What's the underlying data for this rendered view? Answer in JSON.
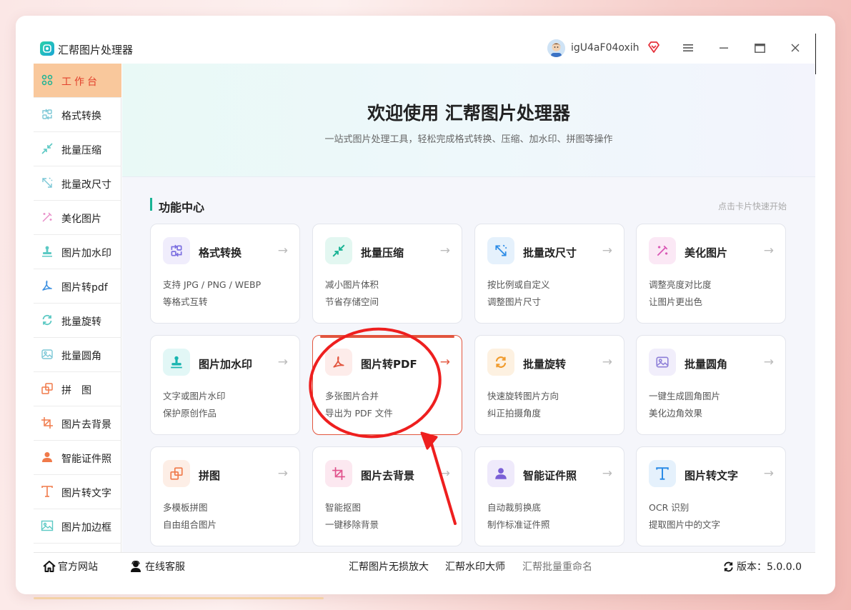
{
  "titlebar": {
    "app_title": "汇帮图片处理器",
    "username": "igU4aF04oxih",
    "menu_icon": "menu-icon",
    "minimize_icon": "minimize-icon",
    "maximize_icon": "maximize-icon",
    "close_icon": "close-icon"
  },
  "sidebar": {
    "items": [
      {
        "label": "工作台",
        "icon": "grid-icon",
        "active": true
      },
      {
        "label": "格式转换",
        "icon": "convert-icon"
      },
      {
        "label": "批量压缩",
        "icon": "compress-icon"
      },
      {
        "label": "批量改尺寸",
        "icon": "resize-icon"
      },
      {
        "label": "美化图片",
        "icon": "beautify-icon"
      },
      {
        "label": "图片加水印",
        "icon": "watermark-icon"
      },
      {
        "label": "图片转pdf",
        "icon": "pdf-icon"
      },
      {
        "label": "批量旋转",
        "icon": "rotate-icon"
      },
      {
        "label": "批量圆角",
        "icon": "round-corner-icon"
      },
      {
        "label": "拼　图",
        "icon": "puzzle-icon"
      },
      {
        "label": "图片去背景",
        "icon": "crop-icon"
      },
      {
        "label": "智能证件照",
        "icon": "person-icon"
      },
      {
        "label": "图片转文字",
        "icon": "text-icon"
      },
      {
        "label": "图片加边框",
        "icon": "frame-icon"
      }
    ]
  },
  "hero": {
    "title": "欢迎使用 汇帮图片处理器",
    "subtitle": "一站式图片处理工具，轻松完成格式转换、压缩、加水印、拼图等操作"
  },
  "section": {
    "title": "功能中心",
    "hint": "点击卡片快速开始"
  },
  "cards": [
    {
      "title": "格式转换",
      "desc1": "支持 JPG / PNG / WEBP",
      "desc2": "等格式互转",
      "arrow": "→",
      "icon": "convert-icon",
      "color": "#7b6ee0",
      "bg": "#f0edfc"
    },
    {
      "title": "批量压缩",
      "desc1": "减小图片体积",
      "desc2": "节省存储空间",
      "arrow": "→",
      "icon": "compress-icon",
      "color": "#19b394",
      "bg": "#e3f7f1"
    },
    {
      "title": "批量改尺寸",
      "desc1": "按比例或自定义",
      "desc2": "调整图片尺寸",
      "arrow": "→",
      "icon": "resize-icon",
      "color": "#2b8be6",
      "bg": "#e5f1fc"
    },
    {
      "title": "美化图片",
      "desc1": "调整亮度对比度",
      "desc2": "让图片更出色",
      "arrow": "→",
      "icon": "beautify-icon",
      "color": "#d957b5",
      "bg": "#fbe8f5"
    },
    {
      "title": "图片加水印",
      "desc1": "文字或图片水印",
      "desc2": "保护原创作品",
      "arrow": "→",
      "icon": "watermark-icon",
      "color": "#18b5b0",
      "bg": "#e2f7f6"
    },
    {
      "title": "图片转PDF",
      "desc1": "多张图片合并",
      "desc2": "导出为 PDF 文件",
      "arrow": "→",
      "icon": "pdf-icon",
      "color": "#e2553e",
      "bg": "#fdecea"
    },
    {
      "title": "批量旋转",
      "desc1": "快速旋转图片方向",
      "desc2": "纠正拍摄角度",
      "arrow": "→",
      "icon": "rotate-icon",
      "color": "#f09a2b",
      "bg": "#fdf1e1"
    },
    {
      "title": "批量圆角",
      "desc1": "一键生成圆角图片",
      "desc2": "美化边角效果",
      "arrow": "→",
      "icon": "round-corner-icon",
      "color": "#8e7fd8",
      "bg": "#f1eefb"
    },
    {
      "title": "拼图",
      "desc1": "多模板拼图",
      "desc2": "自由组合图片",
      "arrow": "→",
      "icon": "puzzle-icon",
      "color": "#f07a4a",
      "bg": "#fdeee6"
    },
    {
      "title": "图片去背景",
      "desc1": "智能抠图",
      "desc2": "一键移除背景",
      "arrow": "→",
      "icon": "crop-icon",
      "color": "#e0508a",
      "bg": "#fce8f0"
    },
    {
      "title": "智能证件照",
      "desc1": "自动裁剪换底",
      "desc2": "制作标准证件照",
      "arrow": "→",
      "icon": "person-icon",
      "color": "#7a5fd6",
      "bg": "#efeafb"
    },
    {
      "title": "图片转文字",
      "desc1": "OCR 识别",
      "desc2": "提取图片中的文字",
      "arrow": "→",
      "icon": "text-icon",
      "color": "#2b8be6",
      "bg": "#e5f1fc"
    }
  ],
  "footer": {
    "website": "官方网站",
    "support": "在线客服",
    "link1": "汇帮图片无损放大",
    "link2": "汇帮水印大师",
    "link3": "汇帮批量重命名",
    "version": "版本：5.0.0.0"
  }
}
